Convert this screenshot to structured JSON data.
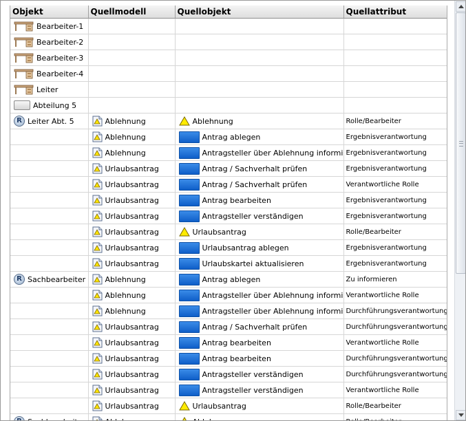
{
  "columns": [
    "Objekt",
    "Quellmodell",
    "Quellobjekt",
    "Quellattribut"
  ],
  "rows": [
    {
      "objekt": {
        "label": "Bearbeiter-1",
        "icon": "desk-icon"
      },
      "quellmodell": null,
      "quellobjekt": null,
      "quellattribut": ""
    },
    {
      "objekt": {
        "label": "Bearbeiter-2",
        "icon": "desk-icon"
      },
      "quellmodell": null,
      "quellobjekt": null,
      "quellattribut": ""
    },
    {
      "objekt": {
        "label": "Bearbeiter-3",
        "icon": "desk-icon"
      },
      "quellmodell": null,
      "quellobjekt": null,
      "quellattribut": ""
    },
    {
      "objekt": {
        "label": "Bearbeiter-4",
        "icon": "desk-icon"
      },
      "quellmodell": null,
      "quellobjekt": null,
      "quellattribut": ""
    },
    {
      "objekt": {
        "label": "Leiter",
        "icon": "desk-icon"
      },
      "quellmodell": null,
      "quellobjekt": null,
      "quellattribut": ""
    },
    {
      "objekt": {
        "label": "Abteilung 5",
        "icon": "organization-unit-icon"
      },
      "quellmodell": null,
      "quellobjekt": null,
      "quellattribut": ""
    },
    {
      "objekt": {
        "label": "Leiter Abt. 5",
        "icon": "role-icon"
      },
      "quellmodell": {
        "label": "Ablehnung",
        "icon": "epc-model-icon"
      },
      "quellobjekt": {
        "label": "Ablehnung",
        "icon": "event-icon"
      },
      "quellattribut": "Rolle/Bearbeiter"
    },
    {
      "objekt": null,
      "quellmodell": {
        "label": "Ablehnung",
        "icon": "epc-model-icon"
      },
      "quellobjekt": {
        "label": "Antrag ablegen",
        "icon": "function-icon"
      },
      "quellattribut": "Ergebnisverantwortung"
    },
    {
      "objekt": null,
      "quellmodell": {
        "label": "Ablehnung",
        "icon": "epc-model-icon"
      },
      "quellobjekt": {
        "label": "Antragsteller über Ablehnung informieren",
        "icon": "function-icon"
      },
      "quellattribut": "Ergebnisverantwortung"
    },
    {
      "objekt": null,
      "quellmodell": {
        "label": "Urlaubsantrag",
        "icon": "epc-model-icon"
      },
      "quellobjekt": {
        "label": "Antrag / Sachverhalt prüfen",
        "icon": "function-icon"
      },
      "quellattribut": "Ergebnisverantwortung"
    },
    {
      "objekt": null,
      "quellmodell": {
        "label": "Urlaubsantrag",
        "icon": "epc-model-icon"
      },
      "quellobjekt": {
        "label": "Antrag / Sachverhalt prüfen",
        "icon": "function-icon"
      },
      "quellattribut": "Verantwortliche Rolle"
    },
    {
      "objekt": null,
      "quellmodell": {
        "label": "Urlaubsantrag",
        "icon": "epc-model-icon"
      },
      "quellobjekt": {
        "label": "Antrag bearbeiten",
        "icon": "function-icon"
      },
      "quellattribut": "Ergebnisverantwortung"
    },
    {
      "objekt": null,
      "quellmodell": {
        "label": "Urlaubsantrag",
        "icon": "epc-model-icon"
      },
      "quellobjekt": {
        "label": "Antragsteller verständigen",
        "icon": "function-icon"
      },
      "quellattribut": "Ergebnisverantwortung"
    },
    {
      "objekt": null,
      "quellmodell": {
        "label": "Urlaubsantrag",
        "icon": "epc-model-icon"
      },
      "quellobjekt": {
        "label": "Urlaubsantrag",
        "icon": "event-icon"
      },
      "quellattribut": "Rolle/Bearbeiter"
    },
    {
      "objekt": null,
      "quellmodell": {
        "label": "Urlaubsantrag",
        "icon": "epc-model-icon"
      },
      "quellobjekt": {
        "label": "Urlaubsantrag ablegen",
        "icon": "function-icon"
      },
      "quellattribut": "Ergebnisverantwortung"
    },
    {
      "objekt": null,
      "quellmodell": {
        "label": "Urlaubsantrag",
        "icon": "epc-model-icon"
      },
      "quellobjekt": {
        "label": "Urlaubskartei aktualisieren",
        "icon": "function-icon"
      },
      "quellattribut": "Ergebnisverantwortung"
    },
    {
      "objekt": {
        "label": "Sachbearbeiter",
        "icon": "role-icon"
      },
      "quellmodell": {
        "label": "Ablehnung",
        "icon": "epc-model-icon"
      },
      "quellobjekt": {
        "label": "Antrag ablegen",
        "icon": "function-icon"
      },
      "quellattribut": "Zu informieren"
    },
    {
      "objekt": null,
      "quellmodell": {
        "label": "Ablehnung",
        "icon": "epc-model-icon"
      },
      "quellobjekt": {
        "label": "Antragsteller über Ablehnung informieren",
        "icon": "function-icon"
      },
      "quellattribut": "Verantwortliche Rolle"
    },
    {
      "objekt": null,
      "quellmodell": {
        "label": "Ablehnung",
        "icon": "epc-model-icon"
      },
      "quellobjekt": {
        "label": "Antragsteller über Ablehnung informieren",
        "icon": "function-icon"
      },
      "quellattribut": "Durchführungsverantwortung"
    },
    {
      "objekt": null,
      "quellmodell": {
        "label": "Urlaubsantrag",
        "icon": "epc-model-icon"
      },
      "quellobjekt": {
        "label": "Antrag / Sachverhalt prüfen",
        "icon": "function-icon"
      },
      "quellattribut": "Durchführungsverantwortung"
    },
    {
      "objekt": null,
      "quellmodell": {
        "label": "Urlaubsantrag",
        "icon": "epc-model-icon"
      },
      "quellobjekt": {
        "label": "Antrag bearbeiten",
        "icon": "function-icon"
      },
      "quellattribut": "Verantwortliche Rolle"
    },
    {
      "objekt": null,
      "quellmodell": {
        "label": "Urlaubsantrag",
        "icon": "epc-model-icon"
      },
      "quellobjekt": {
        "label": "Antrag bearbeiten",
        "icon": "function-icon"
      },
      "quellattribut": "Durchführungsverantwortung"
    },
    {
      "objekt": null,
      "quellmodell": {
        "label": "Urlaubsantrag",
        "icon": "epc-model-icon"
      },
      "quellobjekt": {
        "label": "Antragsteller verständigen",
        "icon": "function-icon"
      },
      "quellattribut": "Durchführungsverantwortung"
    },
    {
      "objekt": null,
      "quellmodell": {
        "label": "Urlaubsantrag",
        "icon": "epc-model-icon"
      },
      "quellobjekt": {
        "label": "Antragsteller verständigen",
        "icon": "function-icon"
      },
      "quellattribut": "Verantwortliche Rolle"
    },
    {
      "objekt": null,
      "quellmodell": {
        "label": "Urlaubsantrag",
        "icon": "epc-model-icon"
      },
      "quellobjekt": {
        "label": "Urlaubsantrag",
        "icon": "event-icon"
      },
      "quellattribut": "Rolle/Bearbeiter"
    },
    {
      "objekt": {
        "label": "Sachbearbeiter",
        "icon": "role-icon"
      },
      "quellmodell": {
        "label": "Ablehnung",
        "icon": "epc-model-icon"
      },
      "quellobjekt": {
        "label": "Ablehnung",
        "icon": "event-icon"
      },
      "quellattribut": "Rolle/Bearbeiter"
    }
  ],
  "colors": {
    "header_bg": "#e6e6e6",
    "grid_line": "#d6d6d6",
    "function_blue": "#1a6fd9",
    "event_yellow": "#ffeb00"
  }
}
